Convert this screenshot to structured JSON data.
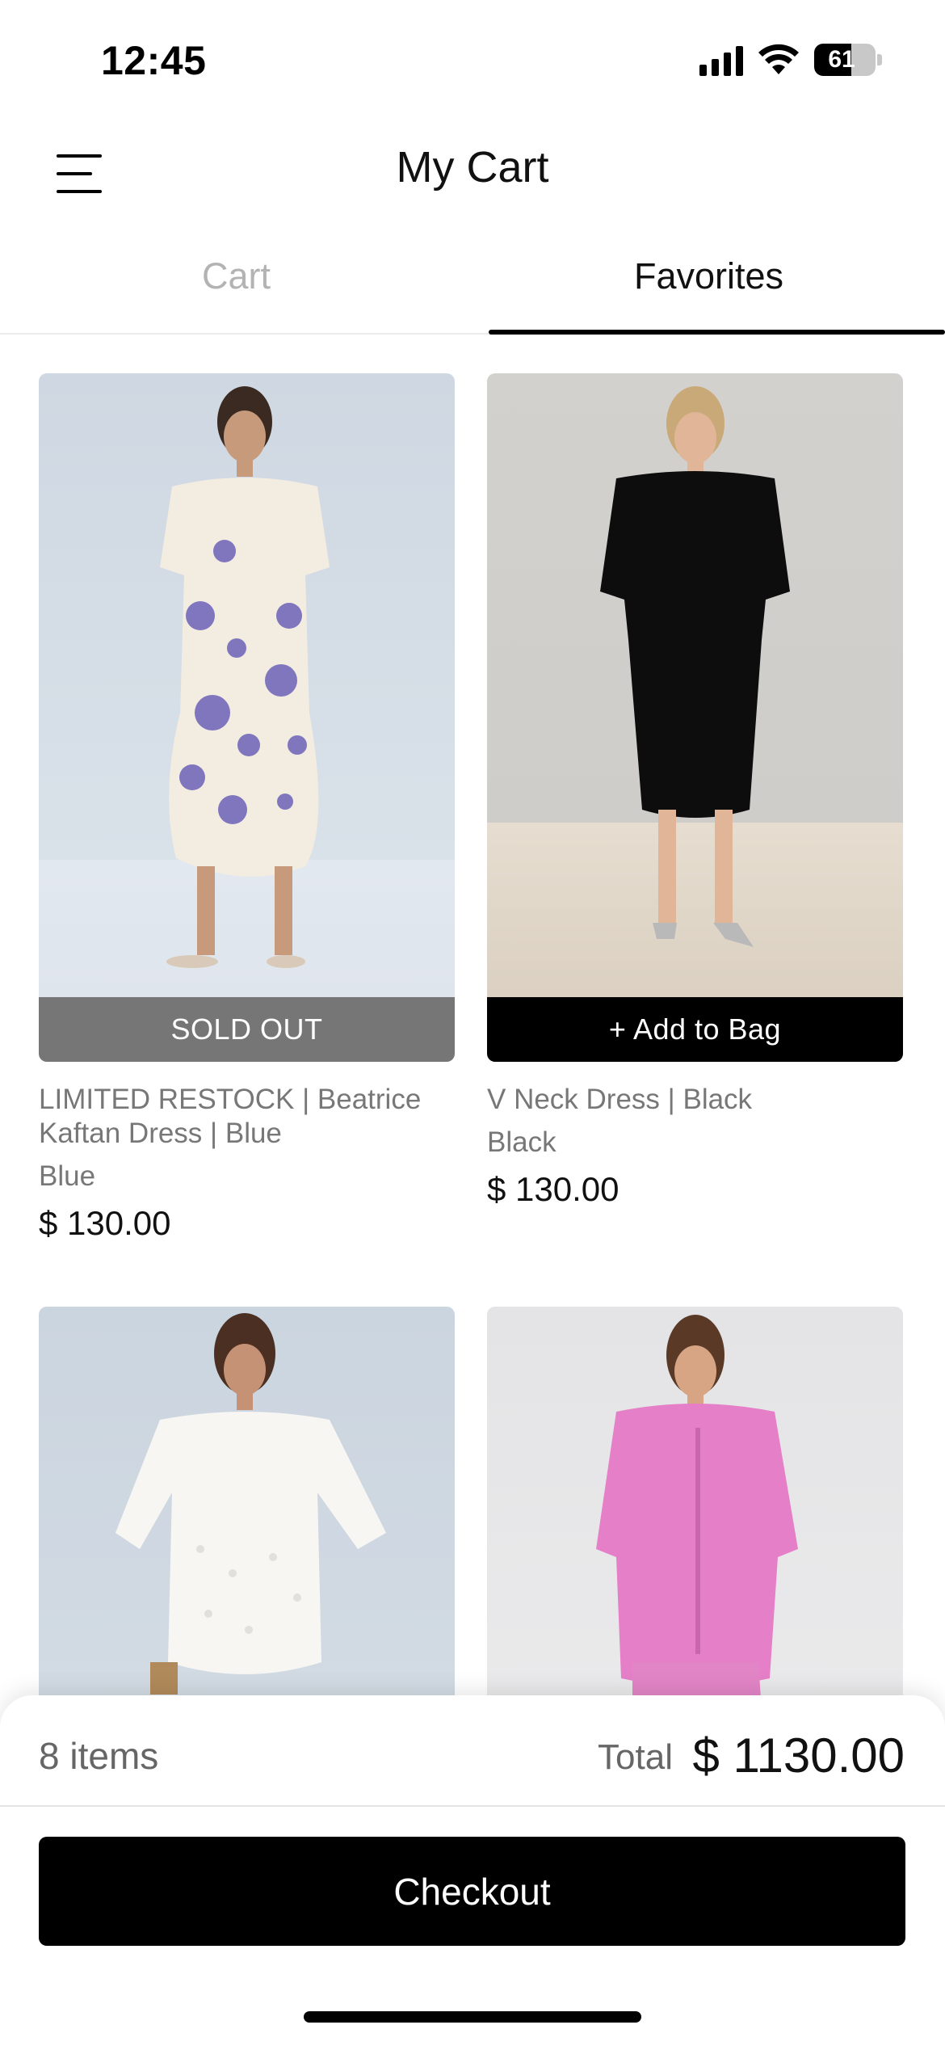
{
  "status_bar": {
    "time": "12:45",
    "battery": "61",
    "battery_fraction": 0.61
  },
  "header": {
    "title": "My Cart",
    "menu_icon": "hamburger-menu-icon"
  },
  "tabs": [
    {
      "label": "Cart",
      "active": false
    },
    {
      "label": "Favorites",
      "active": true
    }
  ],
  "products": [
    {
      "name": "LIMITED RESTOCK | Beatrice Kaftan Dress | Blue",
      "color": "Blue",
      "price": "$ 130.00",
      "action": "SOLD OUT"
    },
    {
      "name": "V Neck Dress | Black",
      "color": "Black",
      "price": "$ 130.00",
      "action": "+ Add to Bag"
    },
    {
      "name": "",
      "color": "",
      "price": "",
      "action": ""
    },
    {
      "name": "",
      "color": "",
      "price": "",
      "action": ""
    }
  ],
  "summary": {
    "items": "8 items",
    "total_label": "Total",
    "total_value": "$ 1130.00"
  },
  "checkout": {
    "label": "Checkout"
  },
  "colors": {
    "sold_out_bg": "#767676",
    "add_bg": "#000000",
    "tab_active": "#111111",
    "tab_inactive": "#b3b3b3"
  }
}
